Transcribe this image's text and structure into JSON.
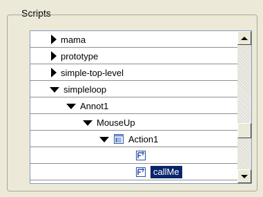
{
  "group": {
    "title": "Scripts"
  },
  "tree": {
    "items": [
      {
        "label": "mama",
        "expander": "triangle-right"
      },
      {
        "label": "prototype",
        "expander": "triangle-right"
      },
      {
        "label": "simple-top-level",
        "expander": "triangle-right"
      },
      {
        "label": "simpleloop",
        "expander": "triangle-down"
      },
      {
        "label": "Annot1",
        "expander": "triangle-down"
      },
      {
        "label": "MouseUp",
        "expander": "triangle-down"
      },
      {
        "label": "Action1",
        "expander": "triangle-down",
        "icon": "script-document-icon"
      },
      {
        "label": "",
        "icon": "function-icon"
      },
      {
        "label": "callMe",
        "icon": "function-icon",
        "selected": true
      }
    ]
  },
  "scrollbar": {
    "up_icon": "arrow-up-icon",
    "down_icon": "arrow-down-icon",
    "position_fraction": 0.82
  },
  "colors": {
    "window_bg": "#ece9d8",
    "tree_bg": "#ffffff",
    "selection_bg": "#0a246a",
    "icon_blue": "#2a4fa8"
  }
}
